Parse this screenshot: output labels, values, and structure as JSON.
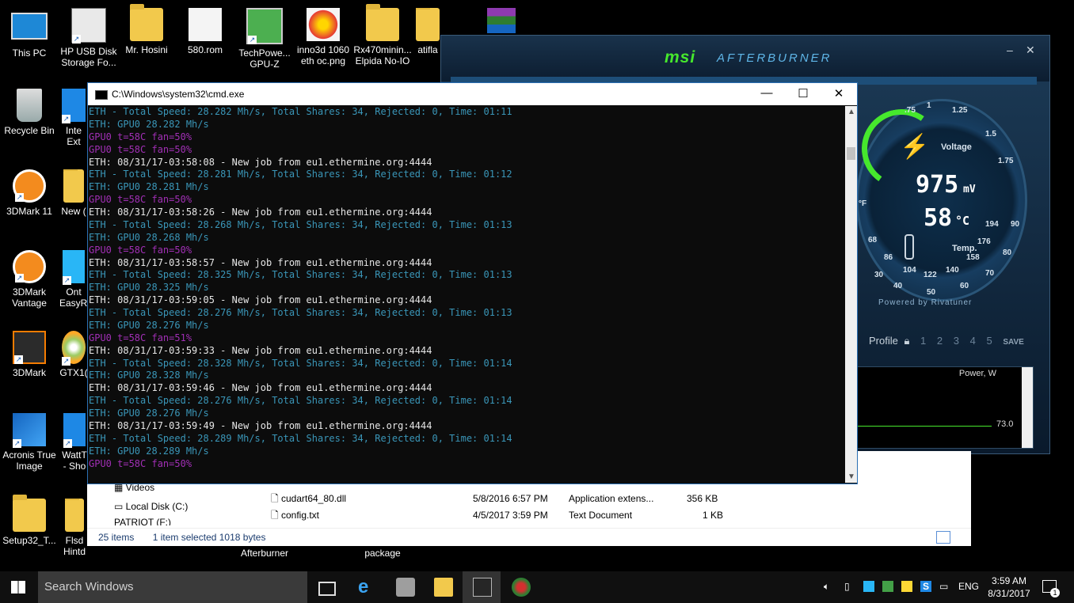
{
  "desktop": {
    "icons": [
      {
        "label": "This PC"
      },
      {
        "label": "HP USB Disk Storage Fo..."
      },
      {
        "label": "Mr. Hosini"
      },
      {
        "label": "580.rom"
      },
      {
        "label": "TechPowe... GPU-Z"
      },
      {
        "label": "inno3d 1060 eth oc.png"
      },
      {
        "label": "Rx470minin... Elpida No-IO"
      },
      {
        "label": "atifla"
      },
      {
        "label": "Recycle Bin"
      },
      {
        "label": "Inte Ext"
      },
      {
        "label": "3DMark 11"
      },
      {
        "label": "New ("
      },
      {
        "label": "3DMark Vantage"
      },
      {
        "label": "Ont EasyRe"
      },
      {
        "label": "3DMark"
      },
      {
        "label": "GTX1("
      },
      {
        "label": "Acronis True Image"
      },
      {
        "label": "WattT - Sho"
      },
      {
        "label": "Setup32_T..."
      },
      {
        "label": "Flsd Hintd"
      },
      {
        "label": "Afterburner"
      },
      {
        "label": "package"
      }
    ]
  },
  "afterburner": {
    "brand": "msi",
    "product": "AFTERBURNER",
    "voltage_label": "Voltage",
    "voltage_value": "975",
    "voltage_unit": "mV",
    "temp_value": "58",
    "temp_unit": "°C",
    "temp_label": "Temp.",
    "powered_by": "Powered by Rivatuner",
    "profile_label": "Profile",
    "profile_slots": [
      "1",
      "2",
      "3",
      "4",
      "5"
    ],
    "save_label": "SAVE",
    "graph_title": "Power, W",
    "graph_value": "73.0",
    "dial_ticks": [
      ".75",
      "1",
      "1.25",
      "1.5",
      "1.75"
    ],
    "temp_ticks": [
      "194",
      "176",
      "158",
      "140",
      "122",
      "104",
      "86",
      "68",
      "°F"
    ],
    "temp_ring_ticks": [
      "30",
      "40",
      "50",
      "60",
      "70",
      "80",
      "90"
    ]
  },
  "cmd": {
    "title": "C:\\Windows\\system32\\cmd.exe",
    "lines": [
      {
        "text": "ETH - Total Speed: 28.282 Mh/s, Total Shares: 34, Rejected: 0, Time: 01:11",
        "style": "cyan"
      },
      {
        "text": "ETH: GPU0 28.282 Mh/s",
        "style": "cyan"
      },
      {
        "text": "GPU0 t=58C fan=50%",
        "style": "purple"
      },
      {
        "text": "GPU0 t=58C fan=50%",
        "style": "purple"
      },
      {
        "text": "ETH: 08/31/17-03:58:08 - New job from eu1.ethermine.org:4444",
        "style": "white"
      },
      {
        "text": "ETH - Total Speed: 28.281 Mh/s, Total Shares: 34, Rejected: 0, Time: 01:12",
        "style": "cyan"
      },
      {
        "text": "ETH: GPU0 28.281 Mh/s",
        "style": "cyan"
      },
      {
        "text": "GPU0 t=58C fan=50%",
        "style": "purple"
      },
      {
        "text": "ETH: 08/31/17-03:58:26 - New job from eu1.ethermine.org:4444",
        "style": "white"
      },
      {
        "text": "ETH - Total Speed: 28.268 Mh/s, Total Shares: 34, Rejected: 0, Time: 01:13",
        "style": "cyan"
      },
      {
        "text": "ETH: GPU0 28.268 Mh/s",
        "style": "cyan"
      },
      {
        "text": "GPU0 t=58C fan=50%",
        "style": "purple"
      },
      {
        "text": "ETH: 08/31/17-03:58:57 - New job from eu1.ethermine.org:4444",
        "style": "white"
      },
      {
        "text": "ETH - Total Speed: 28.325 Mh/s, Total Shares: 34, Rejected: 0, Time: 01:13",
        "style": "cyan"
      },
      {
        "text": "ETH: GPU0 28.325 Mh/s",
        "style": "cyan"
      },
      {
        "text": "ETH: 08/31/17-03:59:05 - New job from eu1.ethermine.org:4444",
        "style": "white"
      },
      {
        "text": "ETH - Total Speed: 28.276 Mh/s, Total Shares: 34, Rejected: 0, Time: 01:13",
        "style": "cyan"
      },
      {
        "text": "ETH: GPU0 28.276 Mh/s",
        "style": "cyan"
      },
      {
        "text": "GPU0 t=58C fan=51%",
        "style": "purple"
      },
      {
        "text": "ETH: 08/31/17-03:59:33 - New job from eu1.ethermine.org:4444",
        "style": "white"
      },
      {
        "text": "ETH - Total Speed: 28.328 Mh/s, Total Shares: 34, Rejected: 0, Time: 01:14",
        "style": "cyan"
      },
      {
        "text": "ETH: GPU0 28.328 Mh/s",
        "style": "cyan"
      },
      {
        "text": "ETH: 08/31/17-03:59:46 - New job from eu1.ethermine.org:4444",
        "style": "white"
      },
      {
        "text": "ETH - Total Speed: 28.276 Mh/s, Total Shares: 34, Rejected: 0, Time: 01:14",
        "style": "cyan"
      },
      {
        "text": "ETH: GPU0 28.276 Mh/s",
        "style": "cyan"
      },
      {
        "text": "ETH: 08/31/17-03:59:49 - New job from eu1.ethermine.org:4444",
        "style": "white"
      },
      {
        "text": "ETH - Total Speed: 28.289 Mh/s, Total Shares: 34, Rejected: 0, Time: 01:14",
        "style": "cyan"
      },
      {
        "text": "ETH: GPU0 28.289 Mh/s",
        "style": "cyan"
      },
      {
        "text": "GPU0 t=58C fan=50%",
        "style": "purple"
      }
    ]
  },
  "explorer": {
    "nav": [
      "Videos",
      "Local Disk (C:)",
      "PATRIOT (F:)"
    ],
    "files": [
      {
        "name": "cudart64_80.dll",
        "date": "5/8/2016 6:57 PM",
        "type": "Application extens...",
        "size": "356 KB"
      },
      {
        "name": "config.txt",
        "date": "4/5/2017 3:59 PM",
        "type": "Text Document",
        "size": "1 KB"
      }
    ],
    "status_items": "25 items",
    "status_selected": "1 item selected  1018 bytes"
  },
  "taskbar": {
    "search_placeholder": "Search Windows",
    "language": "ENG",
    "time": "3:59 AM",
    "date": "8/31/2017",
    "notification_count": "1"
  }
}
